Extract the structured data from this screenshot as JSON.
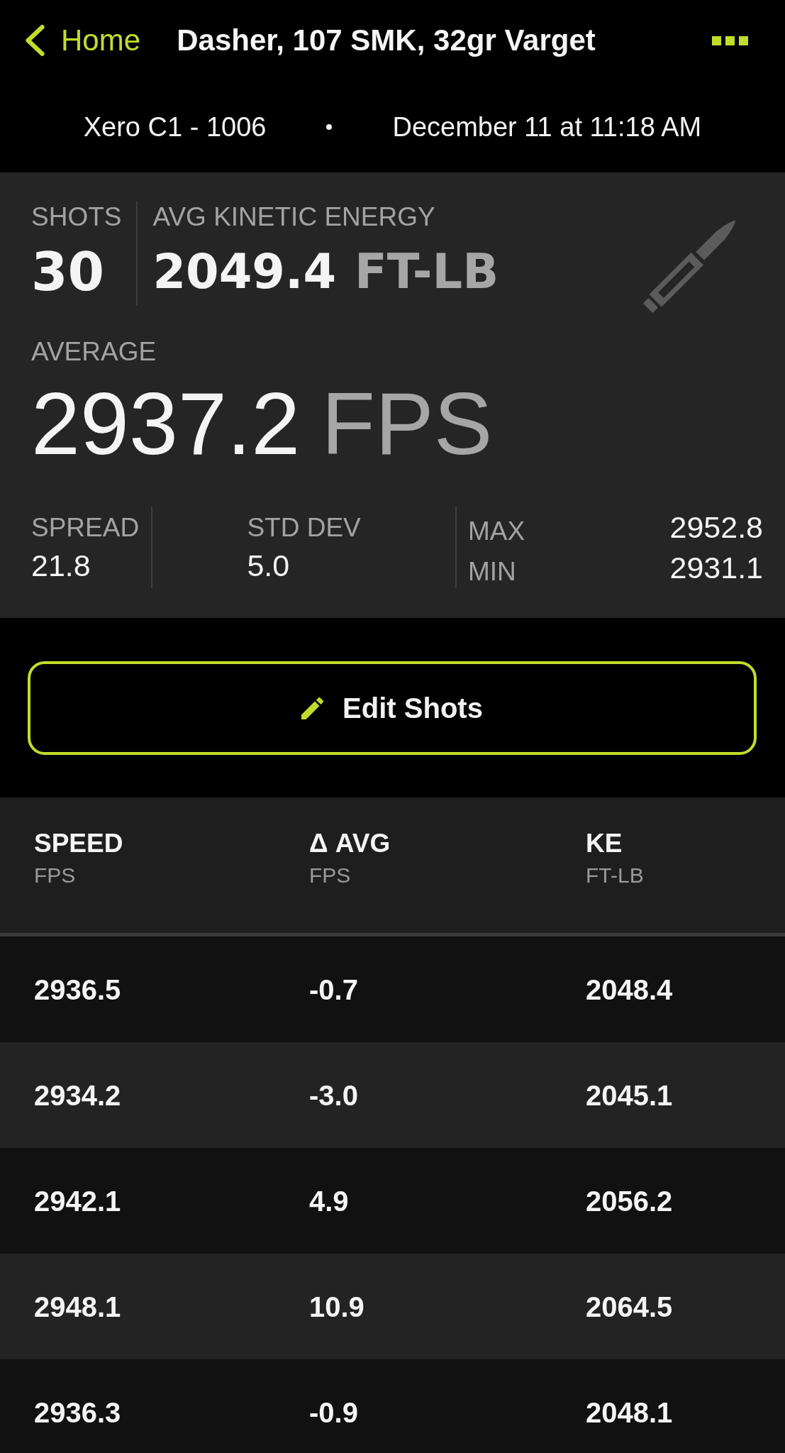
{
  "nav": {
    "back_label": "Home",
    "title": "Dasher, 107 SMK, 32gr Varget"
  },
  "session": {
    "device": "Xero C1 - 1006",
    "date": "December 11 at 11:18 AM"
  },
  "summary": {
    "shots": {
      "label": "SHOTS",
      "value": "30"
    },
    "energy": {
      "label": "AVG KINETIC ENERGY",
      "value": "2049.4",
      "unit": "FT-LB"
    },
    "average": {
      "label": "AVERAGE",
      "value": "2937.2",
      "unit": "FPS"
    },
    "stats": [
      {
        "label": "SPREAD",
        "value": "21.8"
      },
      {
        "label": "STD DEV",
        "value": "5.0"
      }
    ],
    "extremes": [
      {
        "label": "MAX",
        "value": "2952.8"
      },
      {
        "label": "MIN",
        "value": "2931.1"
      }
    ]
  },
  "edit_button": {
    "label": "Edit Shots"
  },
  "table": {
    "columns": [
      {
        "title": "SPEED",
        "unit": "FPS"
      },
      {
        "title": "Δ AVG",
        "unit": "FPS"
      },
      {
        "title": "KE",
        "unit": "FT-LB"
      }
    ],
    "rows": [
      [
        "2936.5",
        "-0.7",
        "2048.4"
      ],
      [
        "2934.2",
        "-3.0",
        "2045.1"
      ],
      [
        "2942.1",
        "4.9",
        "2056.2"
      ],
      [
        "2948.1",
        "10.9",
        "2064.5"
      ],
      [
        "2936.3",
        "-0.9",
        "2048.1"
      ]
    ]
  }
}
